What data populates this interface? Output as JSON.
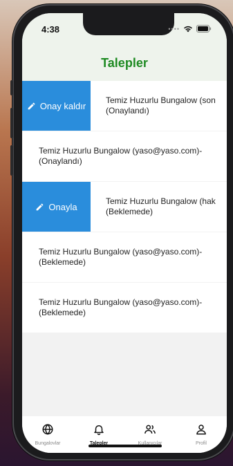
{
  "status_bar": {
    "time": "4:38"
  },
  "header": {
    "title": "Talepler"
  },
  "requests": [
    {
      "text_line1": "Temiz Huzurlu Bungalow  (son",
      "text_line2": "(Onaylandı)",
      "swipe_action": "Onay kaldır",
      "swiped": true
    },
    {
      "text_line1": "Temiz Huzurlu Bungalow  (yaso@yaso.com)-",
      "text_line2": "(Onaylandı)",
      "swiped": false
    },
    {
      "text_line1": "Temiz Huzurlu Bungalow  (hak",
      "text_line2": "(Beklemede)",
      "swipe_action": "Onayla",
      "swiped": true
    },
    {
      "text_line1": "Temiz Huzurlu Bungalow  (yaso@yaso.com)-",
      "text_line2": "(Beklemede)",
      "swiped": false
    },
    {
      "text_line1": "Temiz Huzurlu Bungalow  (yaso@yaso.com)-",
      "text_line2": "(Beklemede)",
      "swiped": false
    }
  ],
  "tabs": [
    {
      "label": "Bungalovlar",
      "icon": "globe-icon"
    },
    {
      "label": "Talepler",
      "icon": "bell-icon",
      "active": true
    },
    {
      "label": "Kullanıcılar",
      "icon": "users-icon"
    },
    {
      "label": "Profil",
      "icon": "user-icon"
    }
  ],
  "colors": {
    "accent": "#2a8ddc",
    "title_green": "#1e8a22",
    "header_bg": "#eef3ec"
  }
}
